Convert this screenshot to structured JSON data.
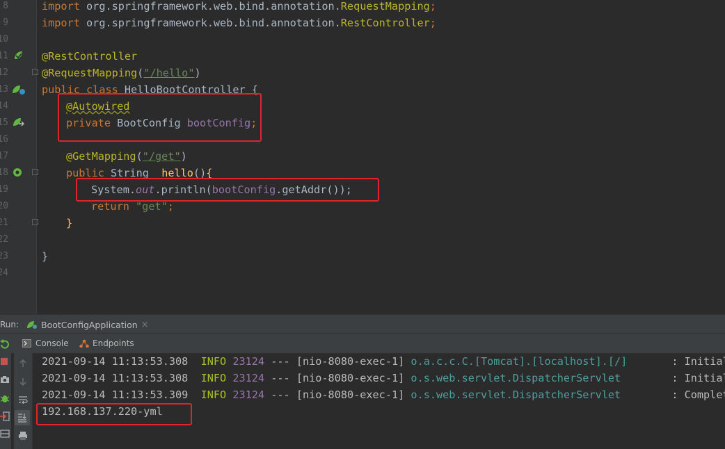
{
  "editor": {
    "line_numbers": [
      "8",
      "9",
      "10",
      "11",
      "12",
      "13",
      "14",
      "15",
      "16",
      "17",
      "18",
      "19",
      "20",
      "21",
      "22",
      "23",
      "24"
    ],
    "imports": [
      {
        "keyword": "import",
        "pkg": "org.springframework.web.bind.annotation.",
        "cls": "RequestMapping",
        "semi": ";"
      },
      {
        "keyword": "import",
        "pkg": "org.springframework.web.bind.annotation.",
        "cls": "RestController",
        "semi": ";"
      }
    ],
    "rest_controller": "@RestController",
    "request_mapping": {
      "ann": "@RequestMapping",
      "open": "(",
      "path": "\"/hello\"",
      "close": ")"
    },
    "class_decl": {
      "kw1": "public",
      "kw2": "class",
      "name": "HelloBootController",
      "brace": "{"
    },
    "autowired": "@Autowired",
    "field_decl": {
      "kw": "private",
      "type": "BootConfig",
      "name": "bootConfig",
      "semi": ";"
    },
    "get_mapping": {
      "ann": "@GetMapping",
      "open": "(",
      "path": "\"/get\"",
      "close": ")"
    },
    "method_decl": {
      "kw": "public",
      "type": "String",
      "name": "hello",
      "parens": "()",
      "brace": "{"
    },
    "println": {
      "pre": "System.",
      "out": "out",
      "mid": ".println(",
      "field": "bootConfig",
      "post": ".getAddr());"
    },
    "return_stmt": {
      "kw": "return",
      "value": "\"get\"",
      "semi": ";"
    },
    "method_close": "}",
    "class_close": "}"
  },
  "run_panel": {
    "label": "Run:",
    "tab_name": "BootConfigApplication",
    "tab_close": "×",
    "tabs": [
      {
        "label": "Console"
      },
      {
        "label": "Endpoints"
      }
    ]
  },
  "console": {
    "lines": [
      {
        "time": "2021-09-14 11:13:53.308",
        "level": "INFO",
        "pid": "23124",
        "sep": "---",
        "thread": "[nio-8080-exec-1]",
        "logger": "o.a.c.c.C.[Tomcat].[localhost].[/]",
        "msg": ": Initiali"
      },
      {
        "time": "2021-09-14 11:13:53.308",
        "level": "INFO",
        "pid": "23124",
        "sep": "---",
        "thread": "[nio-8080-exec-1]",
        "logger": "o.s.web.servlet.DispatcherServlet",
        "msg": ": Initiali"
      },
      {
        "time": "2021-09-14 11:13:53.309",
        "level": "INFO",
        "pid": "23124",
        "sep": "---",
        "thread": "[nio-8080-exec-1]",
        "logger": "o.s.web.servlet.DispatcherServlet",
        "msg": ": Complete"
      }
    ],
    "output": "192.168.137.220-yml"
  },
  "colors": {
    "highlight_box": "#e0242b",
    "keyword": "#cc7832",
    "annotation": "#bbb529",
    "string": "#6a8759",
    "field": "#9876aa",
    "method": "#ffc66d"
  }
}
